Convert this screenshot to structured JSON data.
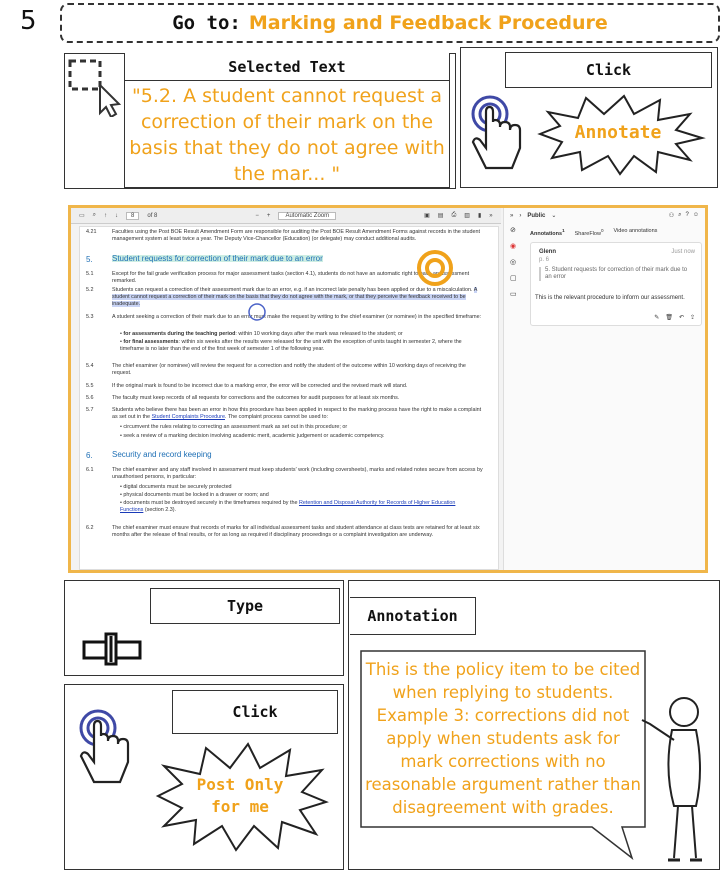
{
  "step_number": "5",
  "goto": {
    "label": "Go to:",
    "target": "Marking and Feedback Procedure"
  },
  "selected_text": {
    "title": "Selected Text",
    "quote": "\"5.2. A student cannot request a correction of their mark on the basis that they do not agree with the mar... \""
  },
  "click_top": {
    "label": "Click",
    "burst": "Annotate"
  },
  "type_panel": {
    "label": "Type"
  },
  "click_bottom": {
    "label": "Click",
    "burst": "Post Only for me"
  },
  "annotation_panel": {
    "label": "Annotation",
    "text": "This is the policy item to be cited when replying to students. Example 3: corrections did not apply when students ask for mark corrections with no reasonable argument rather than disagreement with grades."
  },
  "viewer": {
    "page_field": "8",
    "page_of": "of 8",
    "zoom": "Automatic Zoom",
    "visibility": "Public",
    "tabs": [
      "Annotations",
      "ShareFlow",
      "Video annotations"
    ],
    "tab_counts": [
      "1",
      "0",
      ""
    ],
    "card": {
      "user": "Glenn",
      "time": "Just now",
      "page": "p. 6",
      "quote": "5. Student requests for correction of their mark due to an error",
      "note": "This is the relevant procedure to inform our assessment."
    },
    "doc": {
      "p421_num": "4.21",
      "p421": "Faculties using the Post BOE Result Amendment Form are responsible for auditing the Post BOE Result Amendment Forms against records in the student management system at least twice a year. The Deputy Vice-Chancellor (Education) (or delegate) may conduct additional audits.",
      "h5_num": "5.",
      "h5": "Student requests for correction of their mark due to an error",
      "p51_num": "5.1",
      "p51": "Except for the fail grade verification process for major assessment tasks (section 4.1), students do not have an automatic right to have an assessment remarked.",
      "p52_num": "5.2",
      "p52a": "Students can request a correction of their assessment mark due to an error, e.g. if an incorrect late penalty has been applied or due to a miscalculation.",
      "p52b": "A student cannot request a correction of their mark on the basis that they do not agree with the mark, or that they perceive the feedback received to be inadequate.",
      "p53_num": "5.3",
      "p53": "A student seeking a correction of their mark due to an error must make the request by writing to the chief examiner (or nominee) in the specified timeframe:",
      "b1_bold": "for assessments during the teaching period",
      "b1": ": within 10 working days after the mark was released to the student; or",
      "b2_bold": "for final assessments",
      "b2": ": within six weeks after the results were released for the unit with the exception of units taught in semester 2, where the timeframe is no later than the end of the first week of semester 1 of the following year.",
      "p54_num": "5.4",
      "p54": "The chief examiner (or nominee) will review the request for a correction and notify the student of the outcome within 10 working days of receiving the request.",
      "p55_num": "5.5",
      "p55": "If the original mark is found to be incorrect due to a marking error, the error will be corrected and the revised mark will stand.",
      "p56_num": "5.6",
      "p56": "The faculty must keep records of all requests for corrections and the outcomes for audit purposes for at least six months.",
      "p57_num": "5.7",
      "p57a": "Students who believe there has been an error in how this procedure has been applied in respect to the marking process have the right to make a complaint as set out in the",
      "p57link": "Student Complaints Procedure",
      "p57b": ". The complaint process cannot be used to:",
      "b3": "circumvent the rules relating to correcting an assessment mark as set out in this procedure; or",
      "b4": "seek a review of a marking decision involving academic merit, academic judgement or academic competency.",
      "h6_num": "6.",
      "h6": "Security and record keeping",
      "p61_num": "6.1",
      "p61": "The chief examiner and any staff involved in assessment must keep students' work (including coversheets), marks and related notes secure from access by unauthorised persons, in particular:",
      "b5": "digital documents must be securely protected",
      "b6": "physical documents must be locked in a drawer or room; and",
      "b7a": "documents must be destroyed securely in the timeframes required by the",
      "b7link": "Retention and Disposal Authority for Records of Higher Education Functions",
      "b7b": "(section 2.3).",
      "p62_num": "6.2",
      "p62": "The chief examiner must ensure that records of marks for all individual assessment tasks and student attendance at class tests are retained for at least six months after the release of final results, or for as long as required if disciplinary proceedings or a complaint investigation are underway."
    }
  },
  "colors": {
    "accent": "#f0a21b",
    "frame": "#f0b64a",
    "heading_blue": "#1e6fb5",
    "hand_blue": "#3f49a6"
  }
}
